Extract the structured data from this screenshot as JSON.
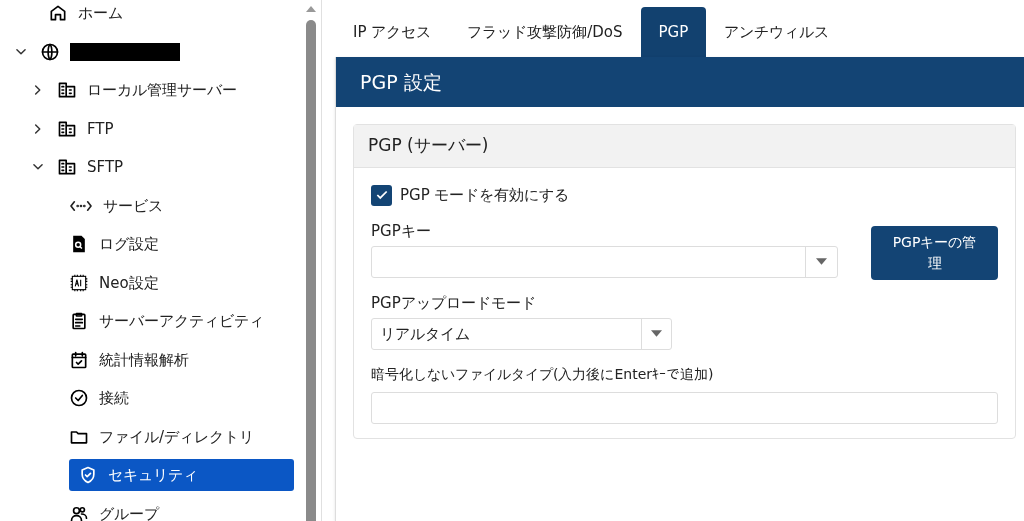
{
  "sidebar": {
    "tree": [
      {
        "label": "ホーム",
        "selected": false
      },
      {
        "redacted": true,
        "expanded": true,
        "selected": false,
        "children": [
          {
            "label": "ローカル管理サーバー",
            "expanded": false,
            "selected": false
          },
          {
            "label": "FTP",
            "expanded": false,
            "selected": false
          },
          {
            "label": "SFTP",
            "expanded": true,
            "selected": false,
            "children": [
              {
                "label": "サービス",
                "selected": false
              },
              {
                "label": "ログ設定",
                "selected": false
              },
              {
                "label": "Neo設定",
                "selected": false
              },
              {
                "label": "サーバーアクティビティ",
                "selected": false
              },
              {
                "label": "統計情報解析",
                "selected": false
              },
              {
                "label": "接続",
                "selected": false
              },
              {
                "label": "ファイル/ディレクトリ",
                "selected": false
              },
              {
                "label": "セキュリティ",
                "selected": true
              },
              {
                "label": "グループ",
                "selected": false
              }
            ]
          }
        ]
      }
    ]
  },
  "tabs": [
    {
      "label": "IP アクセス",
      "selected": false
    },
    {
      "label": "フラッド攻撃防御/DoS",
      "selected": false
    },
    {
      "label": "PGP",
      "selected": true
    },
    {
      "label": "アンチウィルス",
      "selected": false
    }
  ],
  "panel": {
    "title": "PGP 設定",
    "card": {
      "title": "PGP (サーバー)",
      "enable": {
        "label": "PGP モードを有効にする",
        "checked": true
      },
      "key": {
        "label": "PGPキー"
      },
      "manage_button": "PGPキーの管理",
      "upload_mode": {
        "label": "PGPアップロードモード",
        "value": "リアルタイム"
      },
      "exclude": {
        "label": "暗号化しないファイルタイプ(入力後にEnterｷｰで追加)"
      }
    }
  }
}
